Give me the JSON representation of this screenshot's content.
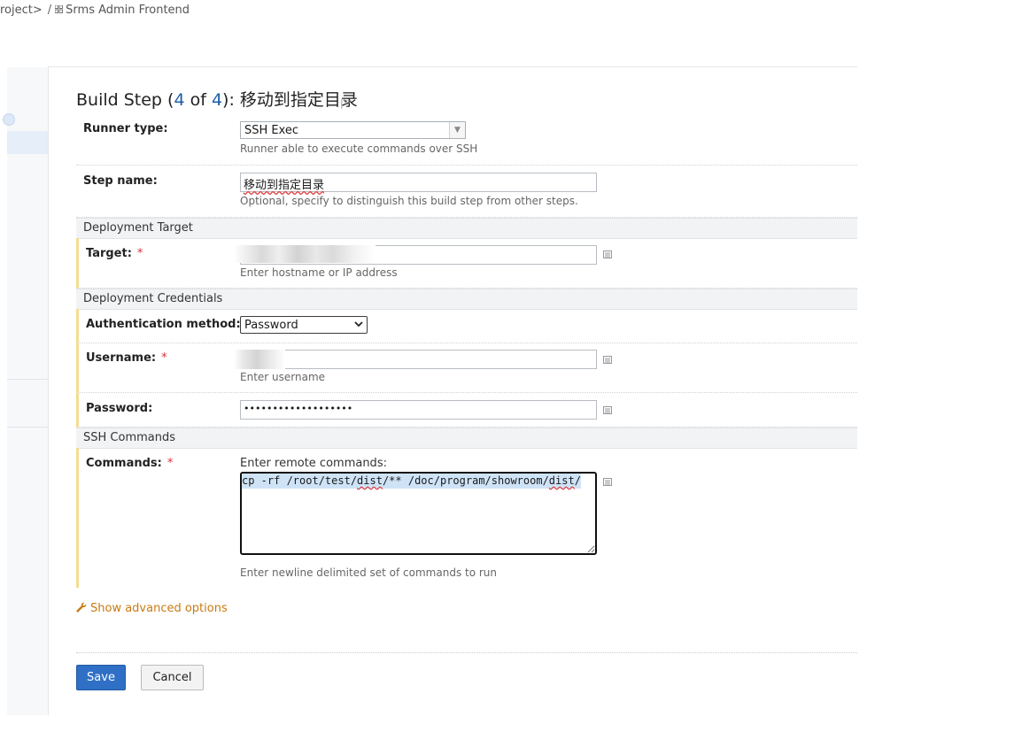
{
  "breadcrumb": {
    "project": "roject>",
    "separator": "/",
    "config": "Srms Admin Frontend"
  },
  "page": {
    "title_prefix": "Build Step (",
    "step_current": "4",
    "title_of": " of ",
    "step_total": "4",
    "title_suffix": "): 移动到指定目录"
  },
  "runner": {
    "label": "Runner type:",
    "value": "SSH Exec",
    "hint": "Runner able to execute commands over SSH"
  },
  "step_name": {
    "label": "Step name:",
    "value": "移动到指定目录",
    "hint": "Optional, specify to distinguish this build step from other steps."
  },
  "sections": {
    "deployment_target": "Deployment Target",
    "deployment_credentials": "Deployment Credentials",
    "ssh_commands": "SSH Commands"
  },
  "target": {
    "label": "Target:",
    "required": "*",
    "value": "",
    "hint": "Enter hostname or IP address"
  },
  "auth": {
    "label": "Authentication method:",
    "value": "Password"
  },
  "username": {
    "label": "Username:",
    "required": "*",
    "value": "",
    "hint": "Enter username"
  },
  "password": {
    "label": "Password:",
    "value": "•••••••••••••••••••"
  },
  "commands": {
    "label": "Commands:",
    "required": "*",
    "prompt": "Enter remote commands:",
    "value": "cp -rf /root/test/dist/** /doc/program/showroom/dist/",
    "hint": "Enter newline delimited set of commands to run"
  },
  "advanced_link": "Show advanced options",
  "buttons": {
    "save": "Save",
    "cancel": "Cancel"
  },
  "colors": {
    "accent": "#2f70c6",
    "link_orange": "#c97a12",
    "required": "#d8323c",
    "required_bar": "#f3dd92"
  }
}
